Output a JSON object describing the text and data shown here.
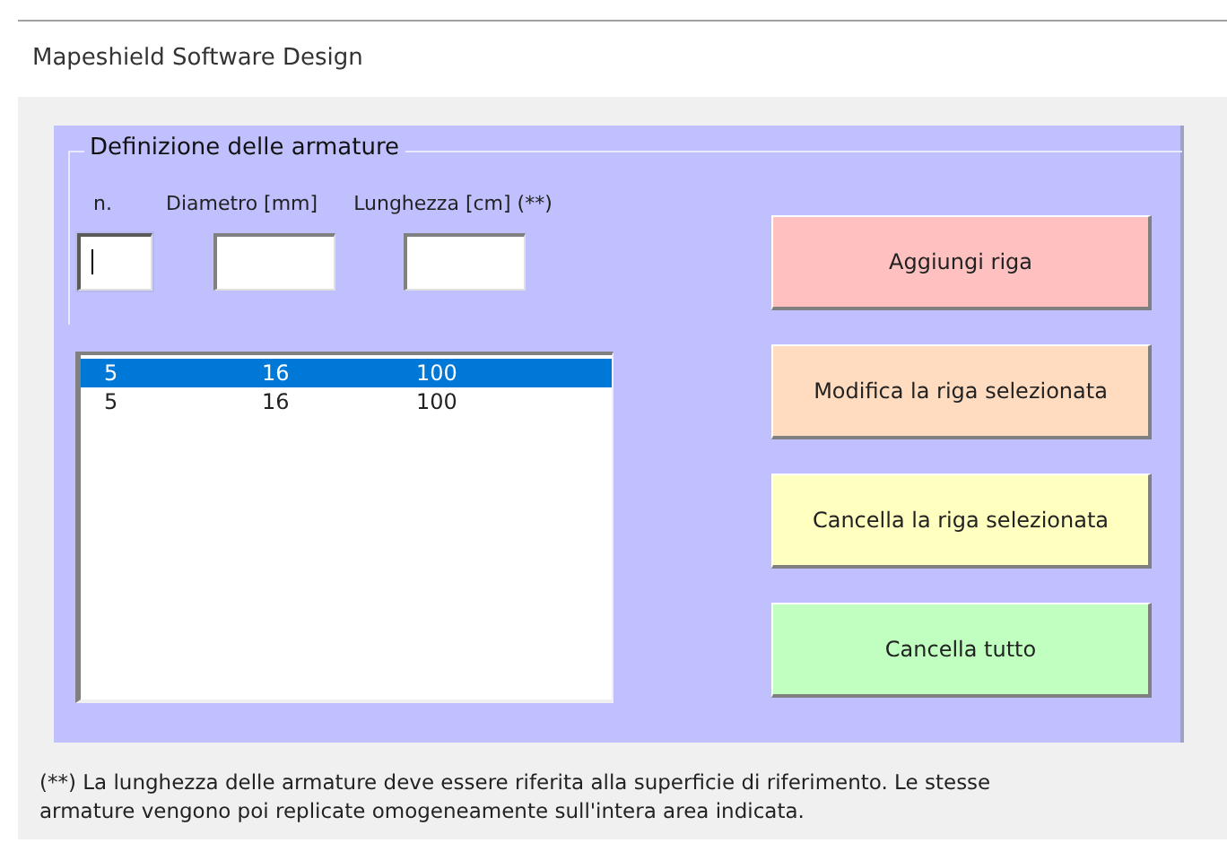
{
  "window": {
    "title": "Mapeshield Software Design"
  },
  "group": {
    "legend": "Definizione delle armature"
  },
  "fields": [
    {
      "label": "n.",
      "focused": true
    },
    {
      "label": "Diametro [mm]",
      "focused": false
    },
    {
      "label": "Lunghezza [cm] (**)",
      "focused": false
    }
  ],
  "list": {
    "rows": [
      {
        "cells": [
          "5",
          "16",
          "100"
        ],
        "selected": true
      },
      {
        "cells": [
          "5",
          "16",
          "100"
        ],
        "selected": false
      }
    ]
  },
  "buttons": [
    {
      "label": "Aggiungi riga",
      "color": "#ffc0c0"
    },
    {
      "label": "Modifica la riga selezionata",
      "color": "#ffdcc0"
    },
    {
      "label": "Cancella la riga selezionata",
      "color": "#ffffc0"
    },
    {
      "label": "Cancella tutto",
      "color": "#c0ffc0"
    }
  ],
  "footnote": "(**) La lunghezza delle armature deve essere riferita alla superficie di riferimento. Le stesse armature vengono poi replicate omogeneamente sull'intera area indicata."
}
